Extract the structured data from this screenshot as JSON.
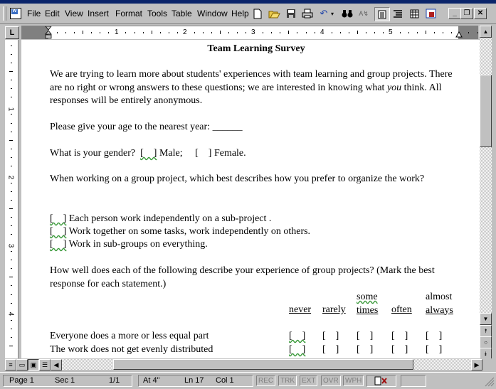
{
  "menubar": {
    "items": [
      {
        "label": "File",
        "u": "F"
      },
      {
        "label": "Edit",
        "u": "E"
      },
      {
        "label": "View",
        "u": "V"
      },
      {
        "label": "Insert",
        "u": "I"
      },
      {
        "label": "Format",
        "u": "o"
      },
      {
        "label": "Tools",
        "u": "T"
      },
      {
        "label": "Table",
        "u": "a"
      },
      {
        "label": "Window",
        "u": "W"
      },
      {
        "label": "Help",
        "u": "H"
      }
    ]
  },
  "toolbar": {
    "icons": [
      "new-document-icon",
      "open-folder-icon",
      "save-disk-icon",
      "print-icon",
      "undo-icon",
      "undo-dropdown-icon",
      "find-binoculars-icon",
      "spelling-icon",
      "normal-view-icon",
      "outline-view-icon",
      "insert-table-icon",
      "excel-icon"
    ]
  },
  "window_controls": {
    "minimize": "_",
    "restore": "❐",
    "close": "✕"
  },
  "ruler": {
    "numbers": [
      "1",
      "2",
      "3",
      "4",
      "5"
    ],
    "vertical_numbers": [
      "1",
      "2",
      "3",
      "4"
    ]
  },
  "document": {
    "title": "Team Learning Survey",
    "intro_a": "We are trying to learn more about students' experiences with team learning and group projects.  There are no right or wrong answers to these questions; we are interested in knowing what ",
    "intro_em": "you",
    "intro_b": " think.  All responses will be entirely anonymous.",
    "age_q": "Please give your age to the nearest year:  ______",
    "gender_q": "What is your gender?  ",
    "gender_box1": "[    ]",
    "gender_male": " Male;     ",
    "gender_box2": "[    ]",
    "gender_female": " Female.",
    "organize_q": "When working on a group project, which best describes how you prefer to organize the work?",
    "organize_options": [
      {
        "box": "[    ]",
        "label": " Each person work independently on a sub-project ."
      },
      {
        "box": "[    ]",
        "label": " Work together on some tasks, work independently on others."
      },
      {
        "box": "[    ]",
        "label": " Work in sub-groups on everything."
      }
    ],
    "experience_q": "How well does each of the following describe your experience of group projects?  (Mark the best response for each statement.)",
    "scale_headers": [
      {
        "top": "",
        "bottom": "never"
      },
      {
        "top": "",
        "bottom": "rarely"
      },
      {
        "top": "some",
        "bottom": "times"
      },
      {
        "top": "",
        "bottom": "often"
      },
      {
        "top": "almost",
        "bottom": "always"
      }
    ],
    "statements": [
      "Everyone does a more or less equal part",
      "The work does not get evenly distributed"
    ],
    "box": "[    ]"
  },
  "statusbar": {
    "page": "Page 1",
    "sec": "Sec 1",
    "pages": "1/1",
    "at": "At 4\"",
    "ln": "Ln 17",
    "col": "Col 1",
    "rec": "REC",
    "trk": "TRK",
    "ext": "EXT",
    "ovr": "OVR",
    "wph": "WPH"
  }
}
